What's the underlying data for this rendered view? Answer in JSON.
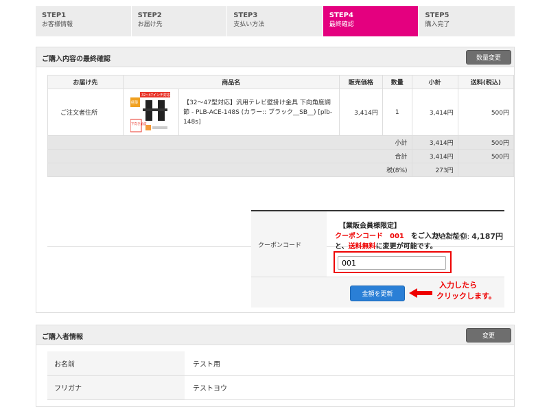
{
  "steps": [
    {
      "num": "STEP1",
      "label": "お客様情報"
    },
    {
      "num": "STEP2",
      "label": "お届け先"
    },
    {
      "num": "STEP3",
      "label": "支払い方法"
    },
    {
      "num": "STEP4",
      "label": "最終確認"
    },
    {
      "num": "STEP5",
      "label": "購入完了"
    }
  ],
  "confirm": {
    "title": "ご購入内容の最終確認",
    "change_qty_label": "数量変更",
    "headers": [
      "お届け先",
      "商品名",
      "販売価格",
      "数量",
      "小計",
      "送料(税込)"
    ],
    "item": {
      "destination": "ご注文者住所",
      "name": "【32～47型対応】汎用テレビ壁掛け金具 下向角度調節 - PLB-ACE-148S (カラー:: ブラック__SB__) [plb-148s]",
      "price": "3,414円",
      "qty": "1",
      "subtotal": "3,414円",
      "shipping": "500円",
      "thumb_badge": "32~47インチ対応",
      "thumb_tag1": "極薄",
      "thumb_tag2": "下向き角度"
    },
    "summary": [
      {
        "label": "小計",
        "amount": "3,414円",
        "shipping": "500円"
      },
      {
        "label": "合計",
        "amount": "3,414円",
        "shipping": "500円"
      },
      {
        "label": "税(8%)",
        "amount": "273円",
        "shipping": ""
      }
    ],
    "grand_total_label": "総合計金額:",
    "grand_total_value": "4,187円"
  },
  "coupon": {
    "label": "クーポンコード",
    "note_line1": "【業販会員様限定】",
    "note_code": "クーポンコード　001",
    "note_line2_rest": "　をご入力いただく",
    "note_line3_pre": "と、",
    "note_free": "送料無料",
    "note_line3_post": "に変更が可能です。",
    "value": "001",
    "update_button": "金額を更新",
    "hint_line1": "入力したら",
    "hint_line2": "クリックします。"
  },
  "buyer": {
    "title": "ご購入者情報",
    "change_label": "変更",
    "rows": [
      {
        "key": "お名前",
        "value": "テスト用"
      },
      {
        "key": "フリガナ",
        "value": "テストヨウ"
      }
    ]
  },
  "colors": {
    "accent": "#e4007f",
    "button_blue": "#2a7fd6",
    "alert_red": "#e00000"
  }
}
